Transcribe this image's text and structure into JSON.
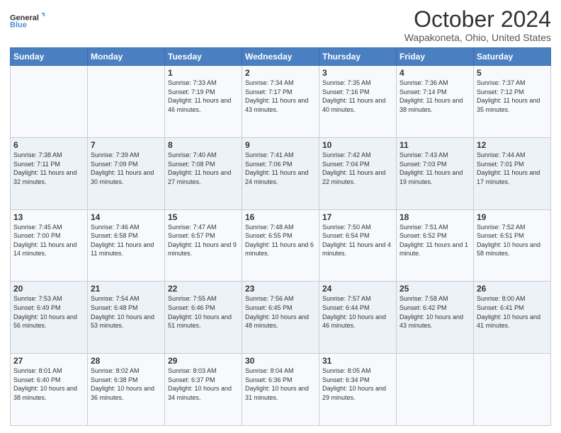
{
  "header": {
    "logo_line1": "General",
    "logo_line2": "Blue",
    "title": "October 2024",
    "subtitle": "Wapakoneta, Ohio, United States"
  },
  "days_of_week": [
    "Sunday",
    "Monday",
    "Tuesday",
    "Wednesday",
    "Thursday",
    "Friday",
    "Saturday"
  ],
  "weeks": [
    [
      {
        "day": "",
        "info": ""
      },
      {
        "day": "",
        "info": ""
      },
      {
        "day": "1",
        "info": "Sunrise: 7:33 AM\nSunset: 7:19 PM\nDaylight: 11 hours and 46 minutes."
      },
      {
        "day": "2",
        "info": "Sunrise: 7:34 AM\nSunset: 7:17 PM\nDaylight: 11 hours and 43 minutes."
      },
      {
        "day": "3",
        "info": "Sunrise: 7:35 AM\nSunset: 7:16 PM\nDaylight: 11 hours and 40 minutes."
      },
      {
        "day": "4",
        "info": "Sunrise: 7:36 AM\nSunset: 7:14 PM\nDaylight: 11 hours and 38 minutes."
      },
      {
        "day": "5",
        "info": "Sunrise: 7:37 AM\nSunset: 7:12 PM\nDaylight: 11 hours and 35 minutes."
      }
    ],
    [
      {
        "day": "6",
        "info": "Sunrise: 7:38 AM\nSunset: 7:11 PM\nDaylight: 11 hours and 32 minutes."
      },
      {
        "day": "7",
        "info": "Sunrise: 7:39 AM\nSunset: 7:09 PM\nDaylight: 11 hours and 30 minutes."
      },
      {
        "day": "8",
        "info": "Sunrise: 7:40 AM\nSunset: 7:08 PM\nDaylight: 11 hours and 27 minutes."
      },
      {
        "day": "9",
        "info": "Sunrise: 7:41 AM\nSunset: 7:06 PM\nDaylight: 11 hours and 24 minutes."
      },
      {
        "day": "10",
        "info": "Sunrise: 7:42 AM\nSunset: 7:04 PM\nDaylight: 11 hours and 22 minutes."
      },
      {
        "day": "11",
        "info": "Sunrise: 7:43 AM\nSunset: 7:03 PM\nDaylight: 11 hours and 19 minutes."
      },
      {
        "day": "12",
        "info": "Sunrise: 7:44 AM\nSunset: 7:01 PM\nDaylight: 11 hours and 17 minutes."
      }
    ],
    [
      {
        "day": "13",
        "info": "Sunrise: 7:45 AM\nSunset: 7:00 PM\nDaylight: 11 hours and 14 minutes."
      },
      {
        "day": "14",
        "info": "Sunrise: 7:46 AM\nSunset: 6:58 PM\nDaylight: 11 hours and 11 minutes."
      },
      {
        "day": "15",
        "info": "Sunrise: 7:47 AM\nSunset: 6:57 PM\nDaylight: 11 hours and 9 minutes."
      },
      {
        "day": "16",
        "info": "Sunrise: 7:48 AM\nSunset: 6:55 PM\nDaylight: 11 hours and 6 minutes."
      },
      {
        "day": "17",
        "info": "Sunrise: 7:50 AM\nSunset: 6:54 PM\nDaylight: 11 hours and 4 minutes."
      },
      {
        "day": "18",
        "info": "Sunrise: 7:51 AM\nSunset: 6:52 PM\nDaylight: 11 hours and 1 minute."
      },
      {
        "day": "19",
        "info": "Sunrise: 7:52 AM\nSunset: 6:51 PM\nDaylight: 10 hours and 58 minutes."
      }
    ],
    [
      {
        "day": "20",
        "info": "Sunrise: 7:53 AM\nSunset: 6:49 PM\nDaylight: 10 hours and 56 minutes."
      },
      {
        "day": "21",
        "info": "Sunrise: 7:54 AM\nSunset: 6:48 PM\nDaylight: 10 hours and 53 minutes."
      },
      {
        "day": "22",
        "info": "Sunrise: 7:55 AM\nSunset: 6:46 PM\nDaylight: 10 hours and 51 minutes."
      },
      {
        "day": "23",
        "info": "Sunrise: 7:56 AM\nSunset: 6:45 PM\nDaylight: 10 hours and 48 minutes."
      },
      {
        "day": "24",
        "info": "Sunrise: 7:57 AM\nSunset: 6:44 PM\nDaylight: 10 hours and 46 minutes."
      },
      {
        "day": "25",
        "info": "Sunrise: 7:58 AM\nSunset: 6:42 PM\nDaylight: 10 hours and 43 minutes."
      },
      {
        "day": "26",
        "info": "Sunrise: 8:00 AM\nSunset: 6:41 PM\nDaylight: 10 hours and 41 minutes."
      }
    ],
    [
      {
        "day": "27",
        "info": "Sunrise: 8:01 AM\nSunset: 6:40 PM\nDaylight: 10 hours and 38 minutes."
      },
      {
        "day": "28",
        "info": "Sunrise: 8:02 AM\nSunset: 6:38 PM\nDaylight: 10 hours and 36 minutes."
      },
      {
        "day": "29",
        "info": "Sunrise: 8:03 AM\nSunset: 6:37 PM\nDaylight: 10 hours and 34 minutes."
      },
      {
        "day": "30",
        "info": "Sunrise: 8:04 AM\nSunset: 6:36 PM\nDaylight: 10 hours and 31 minutes."
      },
      {
        "day": "31",
        "info": "Sunrise: 8:05 AM\nSunset: 6:34 PM\nDaylight: 10 hours and 29 minutes."
      },
      {
        "day": "",
        "info": ""
      },
      {
        "day": "",
        "info": ""
      }
    ]
  ]
}
